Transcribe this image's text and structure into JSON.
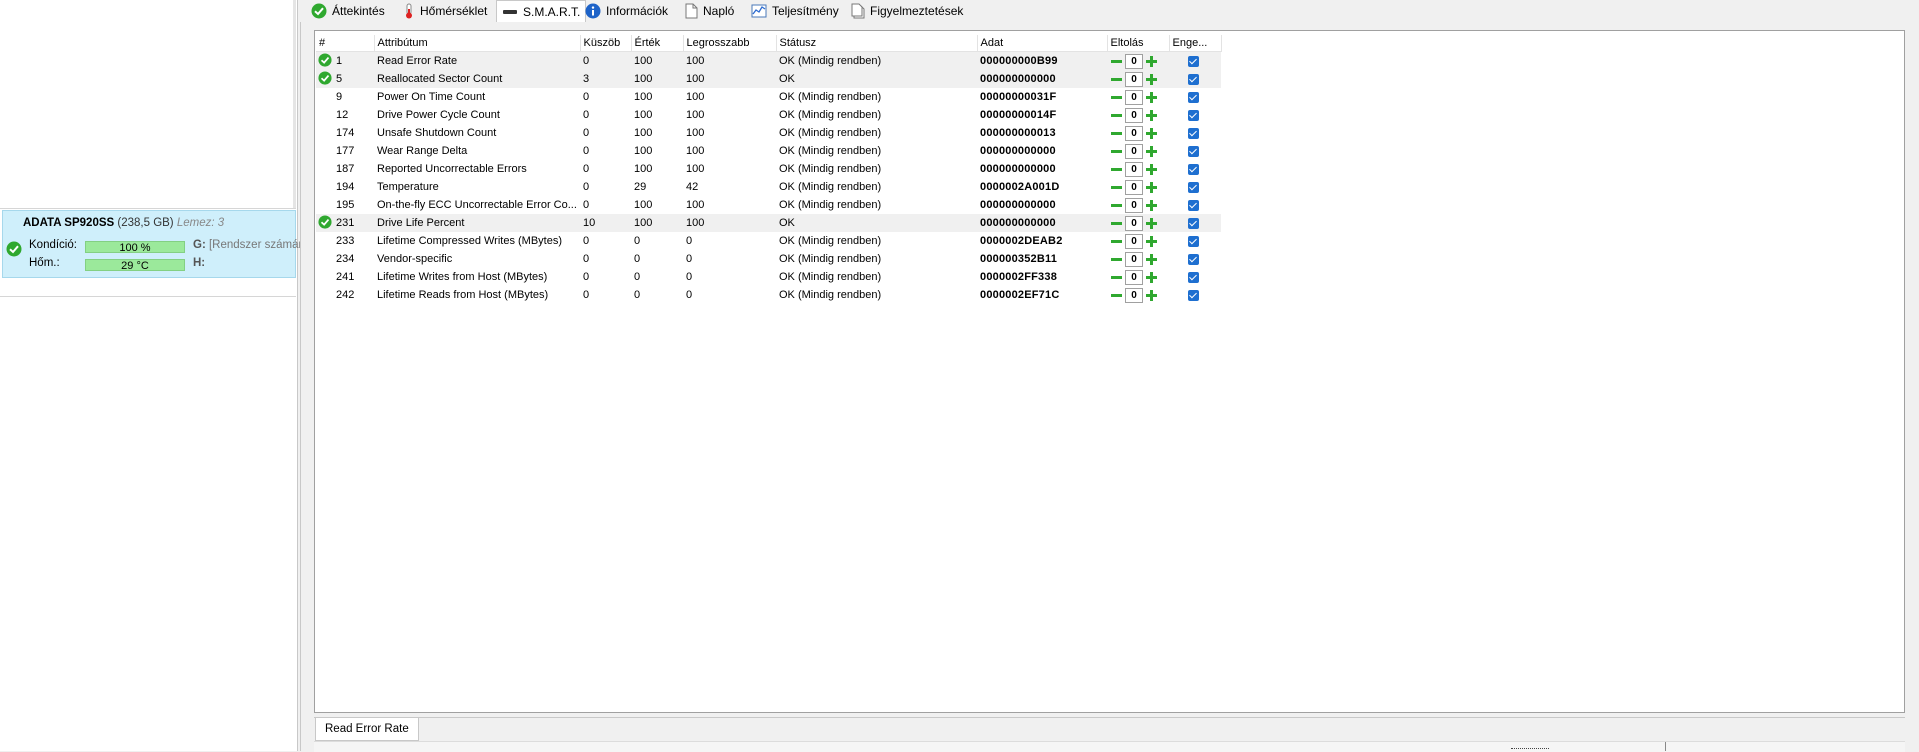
{
  "tabs": [
    {
      "label": "Áttekintés",
      "icon": "check-circle-icon",
      "active": false
    },
    {
      "label": "Hőmérséklet",
      "icon": "thermometer-icon",
      "active": false
    },
    {
      "label": "S.M.A.R.T.",
      "icon": "drive-icon",
      "active": true
    },
    {
      "label": "Információk",
      "icon": "info-icon",
      "active": false
    },
    {
      "label": "Napló",
      "icon": "document-icon",
      "active": false
    },
    {
      "label": "Teljesítmény",
      "icon": "chart-icon",
      "active": false
    },
    {
      "label": "Figyelmeztetések",
      "icon": "alerts-icon",
      "active": false
    }
  ],
  "disk": {
    "name": "ADATA SP920SS",
    "size": "(238,5 GB)",
    "disk_number": "Lemez: 3",
    "condition_label": "Kondíció:",
    "condition_value": "100 %",
    "condition_percent": 100,
    "temp_label": "Hőm.:",
    "temp_value": "29 °C",
    "drive_g_letter": "G:",
    "drive_g_name": "[Rendszer számár",
    "drive_h_letter": "H:"
  },
  "smart_table": {
    "columns": [
      "#",
      "Attribútum",
      "Küszöb",
      "Érték",
      "Legrosszabb",
      "Státusz",
      "Adat",
      "Eltolás",
      "Enge..."
    ],
    "rows": [
      {
        "id": "1",
        "attribute": "Read Error Rate",
        "threshold": "0",
        "value": "100",
        "worst": "100",
        "status": "OK (Mindig rendben)",
        "data": "000000000B99",
        "offset": "0",
        "check": true,
        "highlight": true
      },
      {
        "id": "5",
        "attribute": "Reallocated Sector Count",
        "threshold": "3",
        "value": "100",
        "worst": "100",
        "status": "OK",
        "data": "000000000000",
        "offset": "0",
        "check": true,
        "highlight": true
      },
      {
        "id": "9",
        "attribute": "Power On Time Count",
        "threshold": "0",
        "value": "100",
        "worst": "100",
        "status": "OK (Mindig rendben)",
        "data": "00000000031F",
        "offset": "0",
        "check": false,
        "highlight": false
      },
      {
        "id": "12",
        "attribute": "Drive Power Cycle Count",
        "threshold": "0",
        "value": "100",
        "worst": "100",
        "status": "OK (Mindig rendben)",
        "data": "00000000014F",
        "offset": "0",
        "check": false,
        "highlight": false
      },
      {
        "id": "174",
        "attribute": "Unsafe Shutdown Count",
        "threshold": "0",
        "value": "100",
        "worst": "100",
        "status": "OK (Mindig rendben)",
        "data": "000000000013",
        "offset": "0",
        "check": false,
        "highlight": false
      },
      {
        "id": "177",
        "attribute": "Wear Range Delta",
        "threshold": "0",
        "value": "100",
        "worst": "100",
        "status": "OK (Mindig rendben)",
        "data": "000000000000",
        "offset": "0",
        "check": false,
        "highlight": false
      },
      {
        "id": "187",
        "attribute": "Reported Uncorrectable Errors",
        "threshold": "0",
        "value": "100",
        "worst": "100",
        "status": "OK (Mindig rendben)",
        "data": "000000000000",
        "offset": "0",
        "check": false,
        "highlight": false
      },
      {
        "id": "194",
        "attribute": "Temperature",
        "threshold": "0",
        "value": "29",
        "worst": "42",
        "status": "OK (Mindig rendben)",
        "data": "0000002A001D",
        "offset": "0",
        "check": false,
        "highlight": false
      },
      {
        "id": "195",
        "attribute": "On-the-fly ECC Uncorrectable Error Co...",
        "threshold": "0",
        "value": "100",
        "worst": "100",
        "status": "OK (Mindig rendben)",
        "data": "000000000000",
        "offset": "0",
        "check": false,
        "highlight": false
      },
      {
        "id": "231",
        "attribute": "Drive Life Percent",
        "threshold": "10",
        "value": "100",
        "worst": "100",
        "status": "OK",
        "data": "000000000000",
        "offset": "0",
        "check": true,
        "highlight": true
      },
      {
        "id": "233",
        "attribute": "Lifetime Compressed Writes (MBytes)",
        "threshold": "0",
        "value": "0",
        "worst": "0",
        "status": "OK (Mindig rendben)",
        "data": "0000002DEAB2",
        "offset": "0",
        "check": false,
        "highlight": false
      },
      {
        "id": "234",
        "attribute": "Vendor-specific",
        "threshold": "0",
        "value": "0",
        "worst": "0",
        "status": "OK (Mindig rendben)",
        "data": "000000352B11",
        "offset": "0",
        "check": false,
        "highlight": false
      },
      {
        "id": "241",
        "attribute": "Lifetime Writes from Host (MBytes)",
        "threshold": "0",
        "value": "0",
        "worst": "0",
        "status": "OK (Mindig rendben)",
        "data": "0000002FF338",
        "offset": "0",
        "check": false,
        "highlight": false
      },
      {
        "id": "242",
        "attribute": "Lifetime Reads from Host (MBytes)",
        "threshold": "0",
        "value": "0",
        "worst": "0",
        "status": "OK (Mindig rendben)",
        "data": "0000002EF71C",
        "offset": "0",
        "check": false,
        "highlight": false
      }
    ]
  },
  "bottom_tab": {
    "label": "Read Error Rate"
  },
  "colors": {
    "accent_green": "#2fa82f",
    "card_bg": "#cfeffb",
    "checkbox_blue": "#1e6fd0",
    "bar_green": "#9be99b"
  }
}
